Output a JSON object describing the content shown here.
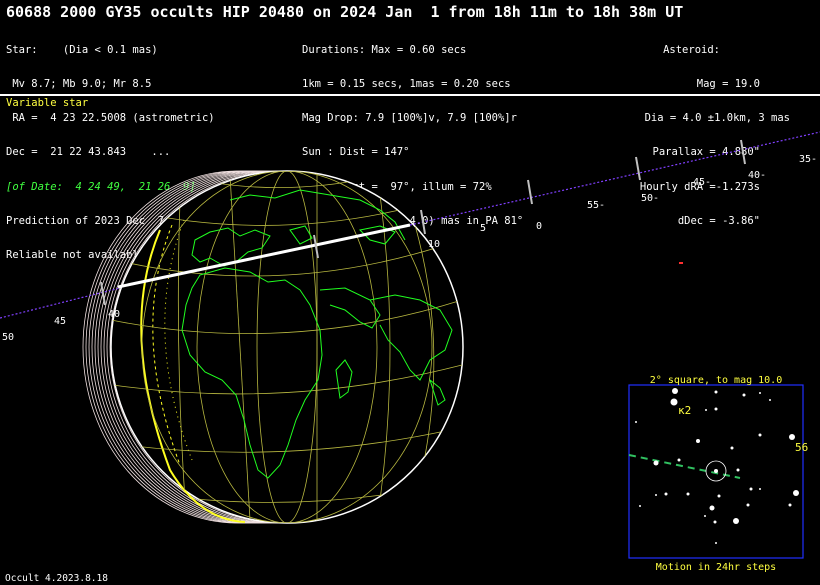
{
  "title": "60688 2000 GY35 occults HIP 20480 on 2024 Jan  1 from 18h 11m to 18h 38m UT",
  "star": {
    "l1": "Star:    (Dia < 0.1 mas)",
    "l2": " Mv 8.7; Mb 9.0; Mr 8.5",
    "l3": " RA =  4 23 22.5008 (astrometric)",
    "l4": "Dec =  21 22 43.843    ...",
    "l5": "[of Date:  4 24 49,  21 26  9]",
    "l6": "Prediction of 2023 Dec  7.0",
    "l7": "Reliable not available"
  },
  "event": {
    "l1": "Durations: Max = 0.60 secs",
    "l2": "1km = 0.15 secs, 1mas = 0.20 secs",
    "l3": "Mag Drop: 7.9 [100%]v, 7.9 [100%]r",
    "l4": "Sun : Dist = 147°",
    "l5": "Moon: Dist =  97°, illum = 72%",
    "l6": "1σ Err: ±(33.0 x 4.0) mas in PA 81°"
  },
  "asteroid": {
    "l1": "Asteroid:",
    "l2": "Mag = 19.0",
    "l3": "Dia = 4.0 ±1.0km, 3 mas",
    "l4": "Parallax = 4.880\"",
    "l5": "Hourly dRA =-1.273s",
    "l6": "dDec = -3.86\""
  },
  "variable_note": "Variable star",
  "track_labels": [
    "50",
    "45",
    "40",
    "10",
    "5",
    "0",
    "55-",
    "50-",
    "45-",
    "40-",
    "35-"
  ],
  "starchart": {
    "title": "2° square, to mag 10.0",
    "footer": "Motion in 24hr steps",
    "label_kappa": "κ2",
    "label_56": "56"
  },
  "footer": "Occult 4.2023.8.18",
  "colors": {
    "grid": "#b8b840",
    "coast": "#20ff20",
    "track": "#8040ff",
    "chart_box": "#2030ff",
    "chart_text": "#ffff40"
  }
}
